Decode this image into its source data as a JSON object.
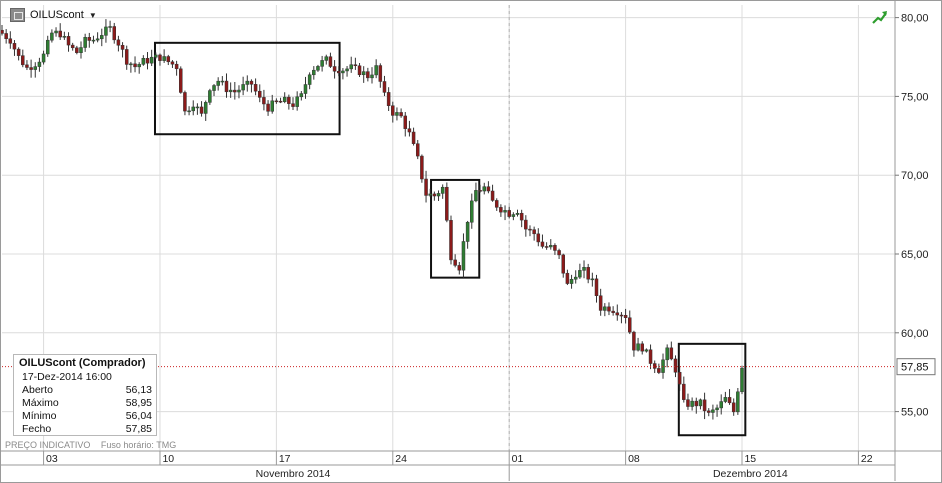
{
  "header": {
    "symbol": "OILUScont",
    "dropdown_glyph": "▼",
    "symbol_icon": "chart-window-icon"
  },
  "trend_icon": {
    "name": "trend-up-arrow-icon",
    "color": "#2e9e2e"
  },
  "info_box": {
    "title": "OILUScont (Comprador)",
    "timestamp": "17-Dez-2014 16:00",
    "rows": [
      {
        "label": "Aberto",
        "value": "56,13"
      },
      {
        "label": "Máximo",
        "value": "58,95"
      },
      {
        "label": "Mínimo",
        "value": "56,04"
      },
      {
        "label": "Fecho",
        "value": "57,85"
      }
    ]
  },
  "footnote": {
    "price_type": "PREÇO INDICATIVO",
    "timezone": "Fuso horário: TMG"
  },
  "colors": {
    "up": "#2e7d32",
    "down": "#8b1a1a",
    "grid": "#dcdcdc",
    "last_line": "#cc2222",
    "bg": "#ffffff"
  },
  "chart_data": {
    "type": "candlestick",
    "symbol": "OILUScont",
    "y_axis": {
      "ticks": [
        "80,00",
        "75,00",
        "70,00",
        "65,00",
        "60,00",
        "55,00"
      ],
      "tick_values": [
        80,
        75,
        70,
        65,
        60,
        55
      ],
      "range": [
        52.5,
        80.8
      ]
    },
    "x_axis": {
      "day_labels": [
        {
          "label": "03",
          "day": 3
        },
        {
          "label": "10",
          "day": 10
        },
        {
          "label": "17",
          "day": 17
        },
        {
          "label": "24",
          "day": 24
        },
        {
          "label": "01",
          "day": 31
        },
        {
          "label": "08",
          "day": 38
        },
        {
          "label": "15",
          "day": 45
        },
        {
          "label": "22",
          "day": 52
        }
      ],
      "month_labels": [
        {
          "label": "Novembro 2014",
          "day": 17.5
        },
        {
          "label": "Dezembro 2014",
          "day": 45
        }
      ],
      "month_separator_days": [
        -0.5,
        30.5,
        59
      ],
      "range": [
        0,
        53.7
      ]
    },
    "last_price": {
      "value": 57.85,
      "label": "57,85"
    },
    "highlight_boxes": [
      {
        "x": [
          9.2,
          20.3
        ],
        "y": [
          72.6,
          78.4
        ]
      },
      {
        "x": [
          25.8,
          28.7
        ],
        "y": [
          63.5,
          69.7
        ]
      },
      {
        "x": [
          40.7,
          44.7
        ],
        "y": [
          53.5,
          59.3
        ]
      }
    ],
    "anchors": [
      [
        0,
        79.0
      ],
      [
        0.5,
        78.6
      ],
      [
        1.0,
        77.5
      ],
      [
        1.5,
        76.8
      ],
      [
        2.0,
        77.1
      ],
      [
        2.5,
        77.6
      ],
      [
        3.0,
        79.0
      ],
      [
        3.5,
        79.0
      ],
      [
        4.0,
        78.2
      ],
      [
        4.5,
        77.8
      ],
      [
        5.0,
        78.5
      ],
      [
        5.5,
        78.6
      ],
      [
        6.0,
        79.0
      ],
      [
        6.5,
        79.3
      ],
      [
        7.0,
        78.4
      ],
      [
        7.5,
        77.3
      ],
      [
        8.0,
        76.9
      ],
      [
        8.5,
        77.2
      ],
      [
        9.0,
        77.4
      ],
      [
        9.5,
        77.5
      ],
      [
        10.0,
        77.2
      ],
      [
        10.5,
        76.9
      ],
      [
        11.0,
        74.0
      ],
      [
        11.5,
        74.6
      ],
      [
        12.0,
        73.8
      ],
      [
        12.5,
        75.6
      ],
      [
        13.0,
        76.0
      ],
      [
        13.5,
        75.5
      ],
      [
        14.0,
        75.3
      ],
      [
        14.5,
        75.6
      ],
      [
        15.0,
        75.8
      ],
      [
        15.5,
        74.8
      ],
      [
        16.0,
        74.3
      ],
      [
        16.5,
        74.6
      ],
      [
        17.0,
        74.7
      ],
      [
        17.5,
        74.5
      ],
      [
        18.0,
        75.0
      ],
      [
        18.5,
        76.6
      ],
      [
        19.0,
        77.0
      ],
      [
        19.5,
        77.3
      ],
      [
        20.0,
        76.8
      ],
      [
        20.5,
        76.7
      ],
      [
        21.0,
        76.8
      ],
      [
        21.5,
        76.6
      ],
      [
        22.0,
        76.3
      ],
      [
        22.5,
        76.8
      ],
      [
        23.0,
        75.0
      ],
      [
        23.5,
        74.0
      ],
      [
        24.0,
        73.7
      ],
      [
        24.5,
        72.6
      ],
      [
        25.0,
        71.0
      ],
      [
        25.5,
        68.8
      ],
      [
        26.0,
        68.7
      ],
      [
        26.5,
        69.2
      ],
      [
        27.0,
        64.9
      ],
      [
        27.5,
        64.2
      ],
      [
        28.0,
        67.2
      ],
      [
        28.5,
        69.0
      ],
      [
        29.0,
        69.2
      ],
      [
        29.5,
        68.3
      ],
      [
        30.0,
        67.9
      ],
      [
        30.5,
        67.6
      ],
      [
        31.0,
        67.8
      ],
      [
        31.5,
        66.6
      ],
      [
        32.0,
        66.3
      ],
      [
        32.5,
        65.5
      ],
      [
        33.0,
        65.4
      ],
      [
        33.5,
        64.8
      ],
      [
        34.0,
        63.0
      ],
      [
        34.5,
        63.8
      ],
      [
        35.0,
        63.9
      ],
      [
        35.5,
        63.2
      ],
      [
        36.0,
        61.6
      ],
      [
        36.5,
        61.6
      ],
      [
        37.0,
        61.4
      ],
      [
        37.5,
        61.1
      ],
      [
        38.0,
        59.1
      ],
      [
        38.5,
        59.1
      ],
      [
        39.0,
        58.2
      ],
      [
        39.5,
        57.7
      ],
      [
        40.0,
        58.8
      ],
      [
        40.5,
        57.7
      ],
      [
        41.0,
        55.5
      ],
      [
        41.5,
        55.5
      ],
      [
        42.0,
        55.5
      ],
      [
        42.5,
        54.8
      ],
      [
        43.0,
        55.2
      ],
      [
        43.5,
        55.8
      ],
      [
        44.0,
        55.0
      ],
      [
        44.5,
        57.9
      ]
    ]
  }
}
